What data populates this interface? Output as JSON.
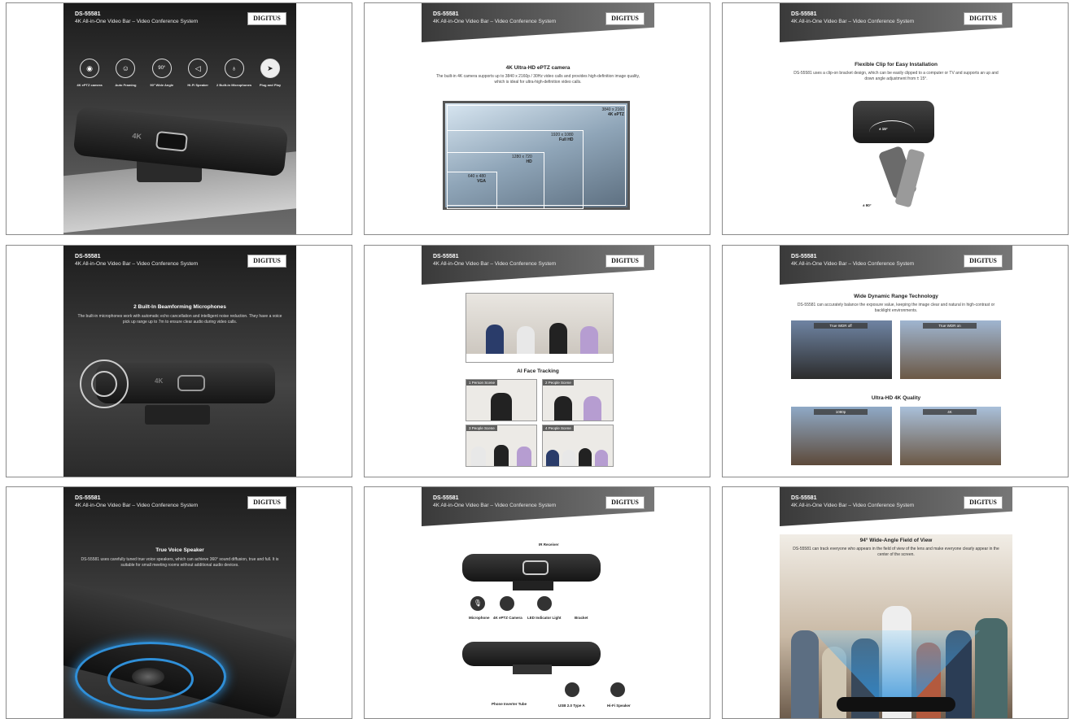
{
  "brand": {
    "model": "DS-55581",
    "subtitle": "4K All-in-One Video Bar – Video Conference System",
    "logo": "DIGITUS"
  },
  "p1": {
    "features": [
      {
        "icon": "camera-icon",
        "label": "4K ePTZ camera"
      },
      {
        "icon": "auto-framing-icon",
        "label": "Auto Framing"
      },
      {
        "icon": "wide-angle-icon",
        "label": "90° Wide Angle",
        "glyph": "90°"
      },
      {
        "icon": "speaker-icon",
        "label": "Hi-Fi Speaker"
      },
      {
        "icon": "microphone-icon",
        "label": "2 Built-in Microphones"
      },
      {
        "icon": "plug-and-play-icon",
        "label": "Plug and Play"
      }
    ],
    "bar_text": "4K"
  },
  "p2": {
    "title": "4K Ultra-HD ePTZ camera",
    "body": "The built-in 4K camera supports up to 3840 x 2160p / 30Hz video calls and provides high-definition image quality, which is ideal for ultra-high-definition video calls.",
    "res": [
      {
        "size": "3840 x 2160",
        "name": "4K ePTZ"
      },
      {
        "size": "1920 x 1080",
        "name": "Full HD"
      },
      {
        "size": "1280 x 720",
        "name": "HD"
      },
      {
        "size": "640 x 480",
        "name": "VGA"
      }
    ]
  },
  "p3": {
    "title": "Flexible Clip for Easy Installation",
    "body": "DS-55581 uses a clip-on bracket design, which can be easily clipped to a computer or TV and supports an up and down angle adjustment from ± 15°.",
    "angle1": "± 15°",
    "angle2": "± 90°"
  },
  "p4": {
    "title": "2 Built-In Beamforming Microphones",
    "body": "The built-in microphones work with automatic echo cancellation and intelligent noise reduction. They have a voice pick up range up to 7m to ensure clear audio during video calls.",
    "bar_text": "4K"
  },
  "p5": {
    "title": "AI Face Tracking",
    "scenes": [
      "1 Person Scene",
      "2 People Scene",
      "3 People Scene",
      "4 People Scene"
    ]
  },
  "p6": {
    "title": "Wide Dynamic Range Technology",
    "body": "DS-55581 can accurately balance the exposure value, keeping the image clear and natural in high-contrast or backlight environments.",
    "wdr_off": "True WDR off",
    "wdr_on": "True WDR on",
    "title2": "Ultra-HD 4K Quality",
    "q1": "1080p",
    "q2": "4K"
  },
  "p7": {
    "title": "True Voice Speaker",
    "body": "DS-55581 uses carefully tuned true voice speakers, which can achieve 360° sound diffusion, true and full. It is suitable for small meeting rooms without additional audio devices."
  },
  "p8": {
    "labels": {
      "ir": "IR Receiver",
      "mic": "Microphone",
      "cam": "4K ePTZ Camera",
      "led": "LED Indicator Light",
      "bracket": "Bracket",
      "phone": "Phone Inverter Tube",
      "usb": "USB 2.0 Type A",
      "hifi": "Hi-Fi Speaker"
    }
  },
  "p9": {
    "title": "94° Wide-Angle Field of View",
    "body": "DS-55581 can track everyone who appears in the field of view of the lens and make everyone clearly appear in the center of the screen."
  },
  "colors": {
    "dark": "#1b1b1b",
    "accent": "#2f8fd8"
  }
}
